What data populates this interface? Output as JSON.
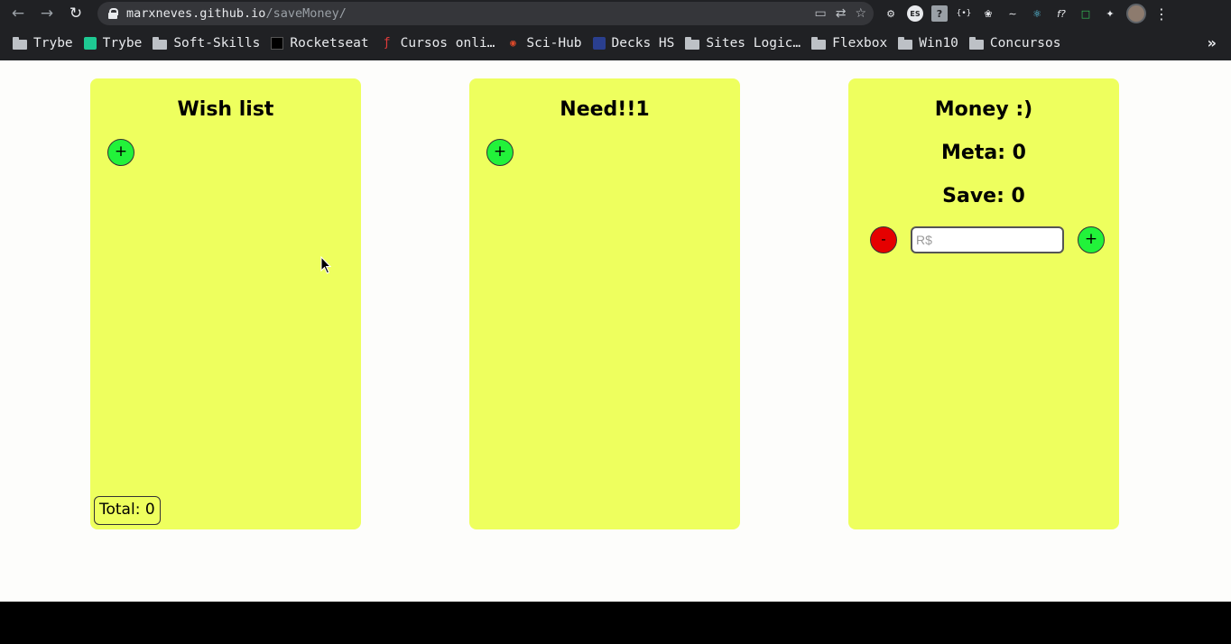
{
  "browser": {
    "url_host": "marxneves.github.io",
    "url_path": "/saveMoney/",
    "bookmarks": [
      {
        "label": "Trybe",
        "icon": "folder-icon"
      },
      {
        "label": "Trybe",
        "icon": "trybe-icon"
      },
      {
        "label": "Soft-Skills",
        "icon": "folder-icon"
      },
      {
        "label": "Rocketseat",
        "icon": "rocketseat-icon"
      },
      {
        "label": "Cursos onli…",
        "icon": "cursos-icon"
      },
      {
        "label": "Sci-Hub",
        "icon": "scihub-icon"
      },
      {
        "label": "Decks HS",
        "icon": "decks-icon"
      },
      {
        "label": "Sites Logic…",
        "icon": "folder-icon"
      },
      {
        "label": "Flexbox",
        "icon": "folder-icon"
      },
      {
        "label": "Win10",
        "icon": "folder-icon"
      },
      {
        "label": "Concursos",
        "icon": "folder-icon"
      }
    ],
    "more_label": "»",
    "extensions": [
      "settings-icon",
      "es-icon",
      "unknown-icon",
      "json-icon",
      "gnome-icon",
      "wave-icon",
      "react-icon",
      "function-icon",
      "screenshot-icon",
      "puzzle-icon"
    ]
  },
  "wish_list": {
    "title": "Wish list",
    "add_label": "+",
    "total_label": "Total: 0"
  },
  "need": {
    "title": "Need!!1",
    "add_label": "+"
  },
  "money": {
    "title": "Money :)",
    "meta_label": "Meta: 0",
    "save_label": "Save: 0",
    "minus_label": "-",
    "plus_label": "+",
    "input_placeholder": "R$",
    "input_value": ""
  },
  "colors": {
    "card": "#eeff5e",
    "add_button": "#22f23a",
    "remove_button": "#e50000",
    "page_bg": "#fdfdfb",
    "chrome_bg": "#202124"
  }
}
